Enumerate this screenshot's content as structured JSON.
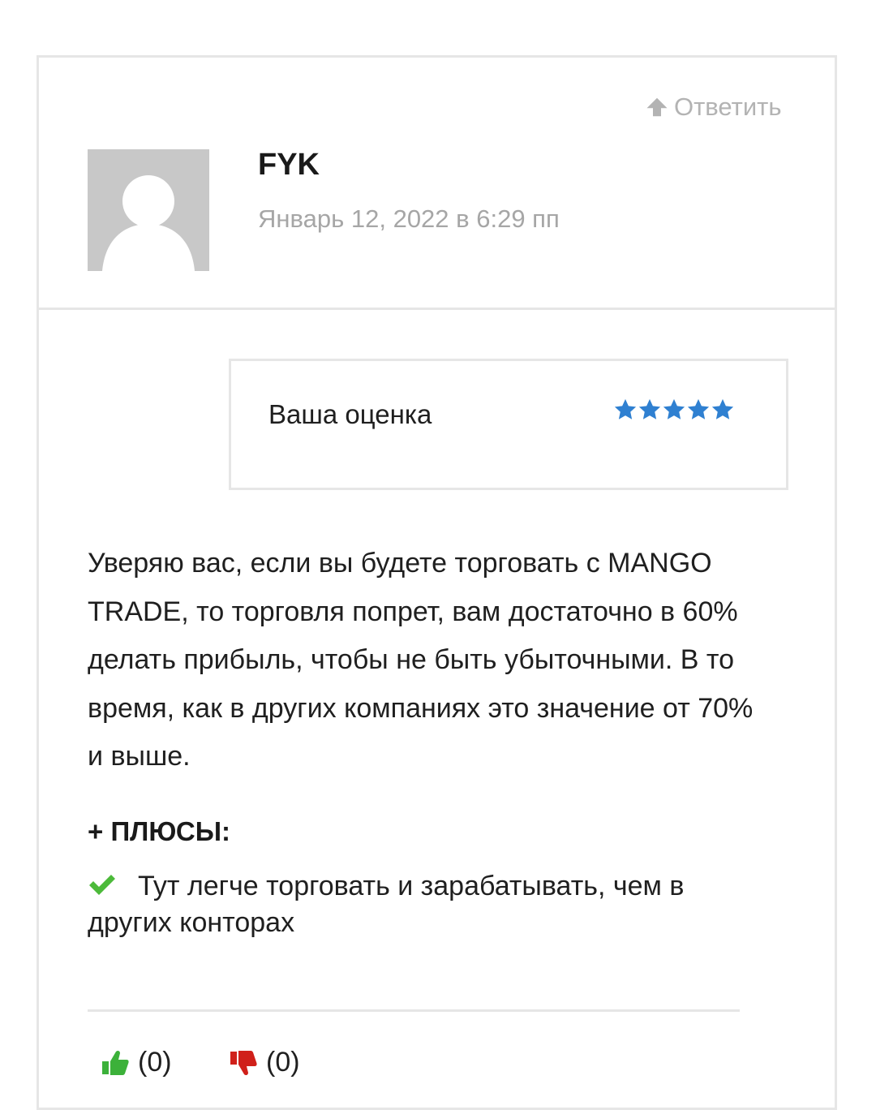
{
  "comment": {
    "reply_label": "Ответить",
    "author": "FYK",
    "date": "Январь 12, 2022 в 6:29 пп",
    "rating": {
      "label": "Ваша оценка",
      "stars": 5,
      "max_stars": 5,
      "star_color": "#2f80d1"
    },
    "body": "Уверяю вас, если вы будете торговать с MANGO TRADE, то торговля попрет, вам достаточно в 60% делать прибыль, чтобы не быть убыточными. В то время, как в других компаниях это значение от 70% и выше.",
    "pros": {
      "title": "+ ПЛЮСЫ:",
      "items": [
        "Тут легче торговать и зарабатывать, чем в других конторах"
      ],
      "icon": "check-icon",
      "icon_color": "#4cba3a"
    },
    "votes": {
      "up_count": "(0)",
      "down_count": "(0)",
      "up_icon": "thumbs-up-icon",
      "down_icon": "thumbs-down-icon",
      "up_color": "#3cb13a",
      "down_color": "#d0201a"
    }
  }
}
